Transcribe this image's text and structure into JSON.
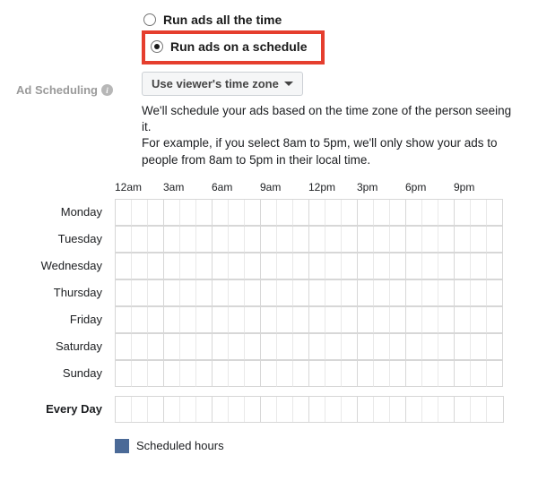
{
  "section": {
    "label": "Ad Scheduling"
  },
  "radio": {
    "option1": "Run ads all the time",
    "option2": "Run ads on a schedule"
  },
  "dropdown": {
    "label": "Use viewer's time zone"
  },
  "desc": {
    "line1": "We'll schedule your ads based on the time zone of the person seeing it.",
    "line2": "For example, if you select 8am to 5pm, we'll only show your ads to people from 8am to 5pm in their local time."
  },
  "time_headers": [
    "12am",
    "3am",
    "6am",
    "9am",
    "12pm",
    "3pm",
    "6pm",
    "9pm"
  ],
  "days": [
    "Monday",
    "Tuesday",
    "Wednesday",
    "Thursday",
    "Friday",
    "Saturday",
    "Sunday"
  ],
  "everyday": "Every Day",
  "legend": {
    "label": "Scheduled hours"
  },
  "colors": {
    "legend_swatch": "#4b6a97",
    "highlight": "#e53e2e"
  }
}
